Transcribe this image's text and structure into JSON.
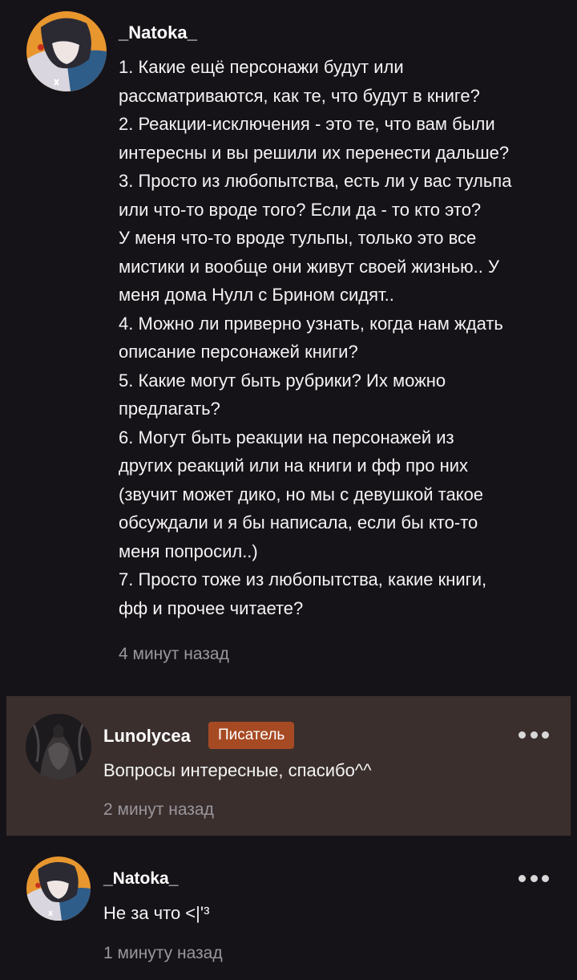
{
  "comment": {
    "author": "_Natoka_",
    "lines": [
      "1. Какие ещё персонажи будут или",
      "рассматриваются, как те, что будут в книге?",
      "2. Реакции-исключения - это те, что вам были",
      "интересны и вы решили их перенести дальше?",
      "3. Просто из любопытства, есть ли у вас тульпа",
      "или что-то вроде того? Если да - то кто это?",
      "У меня что-то вроде тульпы, только это все",
      "мистики и вообще они живут своей жизнью.. У",
      "меня дома Нулл с Брином сидят..",
      "4. Можно ли приверно узнать, когда нам ждать",
      "описание персонажей книги?",
      "5. Какие могут быть рубрики? Их можно",
      "предлагать?",
      "6. Могут быть реакции на персонажей из",
      "других реакций или на книги и фф про них",
      "(звучит может дико, но мы с девушкой такое",
      "обсуждали и я бы написала, если бы кто-то",
      "меня попросил..)",
      "7. Просто тоже из любопытства, какие книги,",
      "фф и прочее читаете?"
    ],
    "timestamp": "4 минут назад",
    "avatar_icon": "anime-avatar"
  },
  "replies": [
    {
      "author": "Lunolycea",
      "badge": "Писатель",
      "text": "Вопросы интересные, спасибо^^",
      "timestamp": "2 минут назад",
      "highlighted": true,
      "avatar_icon": "dark-figure-avatar",
      "menu_icon": "more-dots-icon"
    },
    {
      "author": "_Natoka_",
      "text": "Не за что <|'³",
      "timestamp": "1 минуту назад",
      "avatar_icon": "anime-avatar",
      "menu_icon": "more-dots-icon"
    }
  ],
  "colors": {
    "background": "#161318",
    "highlight_background": "#3a2f2d",
    "badge": "#a64a24",
    "timestamp": "#9a969c",
    "avatar_accent": "#e8962e"
  }
}
